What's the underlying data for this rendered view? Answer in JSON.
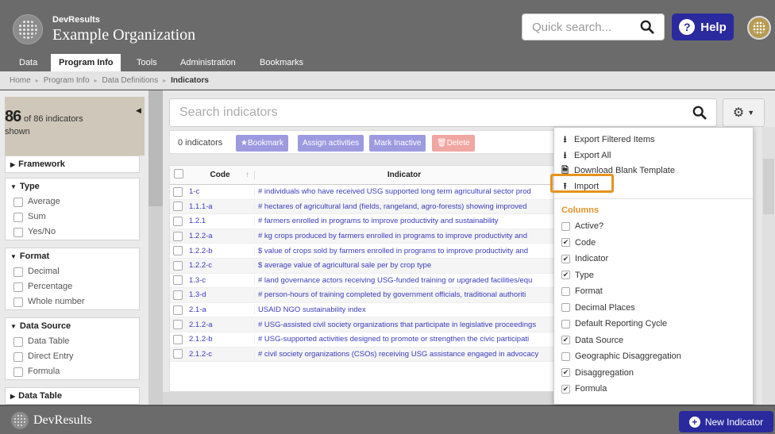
{
  "header": {
    "brand": "DevResults",
    "org_name": "Example Organization",
    "quick_search_placeholder": "Quick search...",
    "help_label": "Help"
  },
  "nav": [
    "Data",
    "Program Info",
    "Tools",
    "Administration",
    "Bookmarks"
  ],
  "breadcrumb": [
    "Home",
    "Program Info",
    "Data Definitions",
    "Indicators"
  ],
  "sidebar": {
    "count": "86",
    "count_suffix": "of 86 indicators",
    "shown": "shown",
    "groups": [
      {
        "title": "Framework",
        "options": []
      },
      {
        "title": "Type",
        "options": [
          "Average",
          "Sum",
          "Yes/No"
        ]
      },
      {
        "title": "Format",
        "options": [
          "Decimal",
          "Percentage",
          "Whole number"
        ]
      },
      {
        "title": "Data Source",
        "options": [
          "Data Table",
          "Direct Entry",
          "Formula"
        ]
      },
      {
        "title": "Data Table",
        "options": []
      }
    ]
  },
  "main": {
    "search_placeholder": "Search indicators",
    "selected_count": "0 indicators",
    "buttons": {
      "bookmark": "Bookmark",
      "assign": "Assign activities",
      "inactive": "Mark Inactive",
      "delete": "Delete"
    },
    "columns": {
      "code": "Code",
      "indicator": "Indicator"
    },
    "rows": [
      {
        "code": "1-c",
        "indicator": "# individuals who have received USG supported long term agricultural sector prod"
      },
      {
        "code": "1.1.1-a",
        "indicator": "# hectares of agricultural land (fields, rangeland, agro-forests) showing improved"
      },
      {
        "code": "1.2.1",
        "indicator": "# farmers enrolled in programs to improve productivity and sustainability"
      },
      {
        "code": "1.2.2-a",
        "indicator": "# kg crops produced by farmers enrolled in programs to improve productivity and"
      },
      {
        "code": "1.2.2-b",
        "indicator": "$ value of crops sold by farmers enrolled in programs to improve productivity and"
      },
      {
        "code": "1.2.2-c",
        "indicator": "$ average value of agricultural sale per by crop type"
      },
      {
        "code": "1.3-c",
        "indicator": "# land governance actors receiving USG-funded training or upgraded facilities/equ"
      },
      {
        "code": "1.3-d",
        "indicator": "# person-hours of training completed by government officials, traditional authoriti"
      },
      {
        "code": "2.1-a",
        "indicator": "USAID NGO sustainability index"
      },
      {
        "code": "2.1.2-a",
        "indicator": "# USG-assisted civil society organizations that participate in legislative proceedings"
      },
      {
        "code": "2.1.2-b",
        "indicator": "# USG-supported activities designed to promote or strengthen the civic participati"
      },
      {
        "code": "2.1.2-c",
        "indicator": "# civil society organizations (CSOs) receiving USG assistance engaged in advocacy"
      }
    ]
  },
  "dropdown": {
    "actions": [
      {
        "icon": "download-icon",
        "glyph": "⭳",
        "label": "Export Filtered Items"
      },
      {
        "icon": "download-icon",
        "glyph": "⭳",
        "label": "Export All"
      },
      {
        "icon": "file-icon",
        "glyph": "🗎",
        "label": "Download Blank Template"
      },
      {
        "icon": "upload-icon",
        "glyph": "⭱",
        "label": "Import"
      }
    ],
    "columns_title": "Columns",
    "columns": [
      {
        "label": "Active?",
        "checked": false
      },
      {
        "label": "Code",
        "checked": true
      },
      {
        "label": "Indicator",
        "checked": true
      },
      {
        "label": "Type",
        "checked": true
      },
      {
        "label": "Format",
        "checked": false
      },
      {
        "label": "Decimal Places",
        "checked": false
      },
      {
        "label": "Default Reporting Cycle",
        "checked": false
      },
      {
        "label": "Data Source",
        "checked": true
      },
      {
        "label": "Geographic Disaggregation",
        "checked": false
      },
      {
        "label": "Disaggregation",
        "checked": true
      },
      {
        "label": "Formula",
        "checked": true
      }
    ]
  },
  "footer": {
    "brand": "DevResults",
    "new_indicator": "New Indicator"
  },
  "colors": {
    "header_bg": "#6b6b6b",
    "primary_button": "#2a2a9e",
    "link": "#3b3bbd",
    "highlight_orange": "#e5921e",
    "columns_title": "#e39328"
  }
}
